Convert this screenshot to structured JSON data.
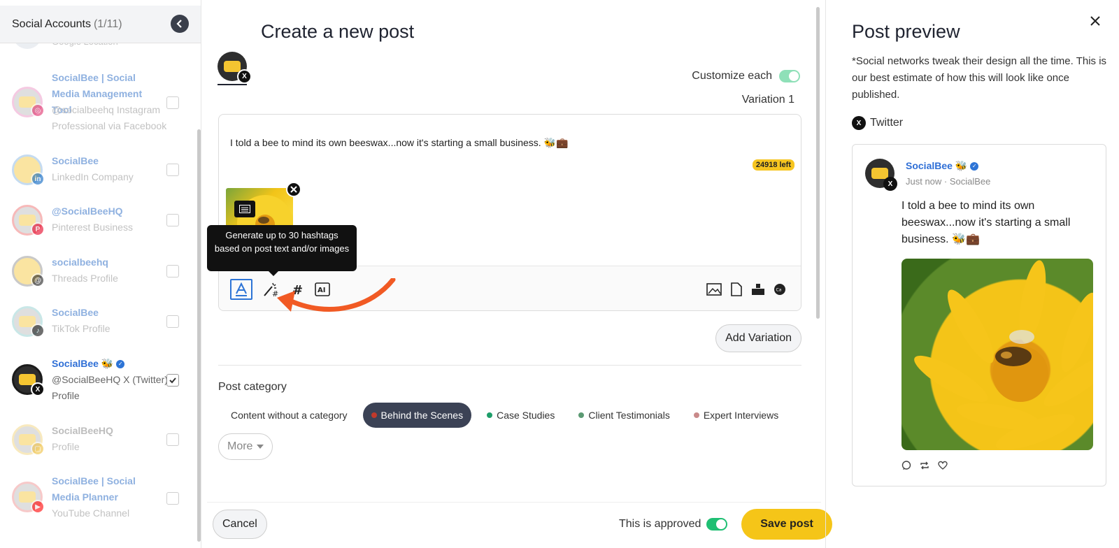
{
  "sidebar": {
    "title": "Social Accounts",
    "count": "(1/11)",
    "partial_label": "Google Location",
    "accounts": [
      {
        "name": "SocialBee | Social Media Management Tool",
        "desc": "@socialbeehq Instagram Professional via Facebook",
        "badge": "instagram-icon"
      },
      {
        "name": "SocialBee",
        "desc": "LinkedIn Company",
        "badge": "linkedin-icon"
      },
      {
        "name": "@SocialBeeHQ",
        "desc": "Pinterest Business",
        "badge": "pinterest-icon"
      },
      {
        "name": "socialbeehq",
        "desc": "Threads Profile",
        "badge": "threads-icon"
      },
      {
        "name": "SocialBee",
        "desc": "TikTok Profile",
        "badge": "tiktok-icon"
      },
      {
        "name": "SocialBee 🐝",
        "desc": "@SocialBeeHQ X (Twitter) Profile",
        "badge": "x-icon",
        "checked": true
      },
      {
        "name": "SocialBeeHQ",
        "desc": "Profile",
        "badge": "generic-icon"
      },
      {
        "name": "SocialBee | Social Media Planner",
        "desc": "YouTube Channel",
        "badge": "youtube-icon"
      }
    ]
  },
  "main": {
    "title": "Create a new post",
    "customize_label": "Customize each",
    "variation_label": "Variation 1",
    "post_text": "I told a bee to mind its own beeswax...now it's starting a small business. 🐝💼",
    "chars_left": "24918 left",
    "tooltip": "Generate up to 30 hashtags based on post text and/or images",
    "add_variation": "Add Variation",
    "category_title": "Post category",
    "categories": [
      {
        "label": "Content without a category",
        "color": ""
      },
      {
        "label": "Behind the Scenes",
        "color": "#c0392b"
      },
      {
        "label": "Case Studies",
        "color": "#1e9e6a"
      },
      {
        "label": "Client Testimonials",
        "color": "#5b9a73"
      },
      {
        "label": "Expert Interviews",
        "color": "#c98a8a"
      }
    ],
    "more_label": "More",
    "cancel_label": "Cancel",
    "approved_label": "This is approved",
    "save_label": "Save post"
  },
  "preview": {
    "title": "Post preview",
    "note": "*Social networks tweak their design all the time. This is our best estimate of how this will look like once published.",
    "network": "Twitter",
    "name": "SocialBee 🐝",
    "meta": "Just now · SocialBee",
    "text": "I told a bee to mind its own beeswax...now it's starting a small business. 🐝💼"
  },
  "colors": {
    "accent": "#f5c518",
    "link": "#2f6fd6",
    "toggle": "#1fbf73",
    "selected_tool": "#2d74d6",
    "arrow": "#f15a24"
  }
}
